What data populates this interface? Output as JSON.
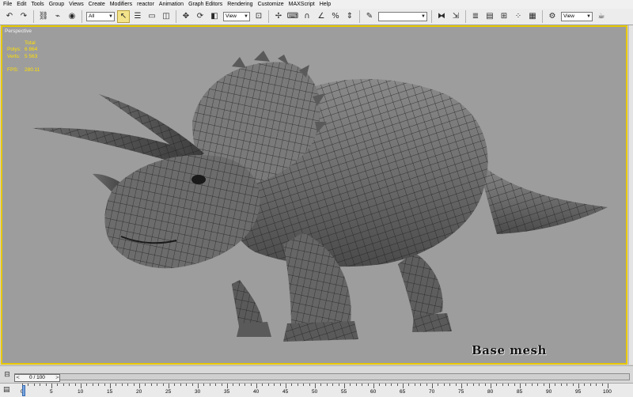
{
  "menubar": {
    "items": [
      "File",
      "Edit",
      "Tools",
      "Group",
      "Views",
      "Create",
      "Modifiers",
      "reactor",
      "Animation",
      "Graph Editors",
      "Rendering",
      "Customize",
      "MAXScript",
      "Help"
    ]
  },
  "toolbar": {
    "undo_icon": "undo-arrow-icon",
    "redo_icon": "redo-arrow-icon",
    "selection_filter": "All",
    "reference_coordinate_system": "View",
    "named_selection_set": "",
    "render_view": "View",
    "active_tool": "select-object"
  },
  "viewport": {
    "label": "Perspective",
    "stats": {
      "total_label": "Total",
      "polys_label": "Polys:",
      "polys_value": "6 864",
      "verts_label": "Verts:",
      "verts_value": "5 563",
      "fps_label": "FPS:",
      "fps_value": "280.11"
    },
    "caption": "Base mesh",
    "model": "triceratops polygon mesh",
    "background_color": "#9d9d9d",
    "border_color": "#e6c800",
    "stats_color": "#ffe000"
  },
  "timeslider": {
    "current": "0 / 100",
    "prev_symbol": "<",
    "next_symbol": ">"
  },
  "trackbar": {
    "tick_labels": [
      "0",
      "5",
      "10",
      "15",
      "20",
      "25",
      "30",
      "35",
      "40",
      "45",
      "50",
      "55",
      "60",
      "65",
      "70",
      "75",
      "80",
      "85",
      "90",
      "95",
      "100"
    ]
  }
}
